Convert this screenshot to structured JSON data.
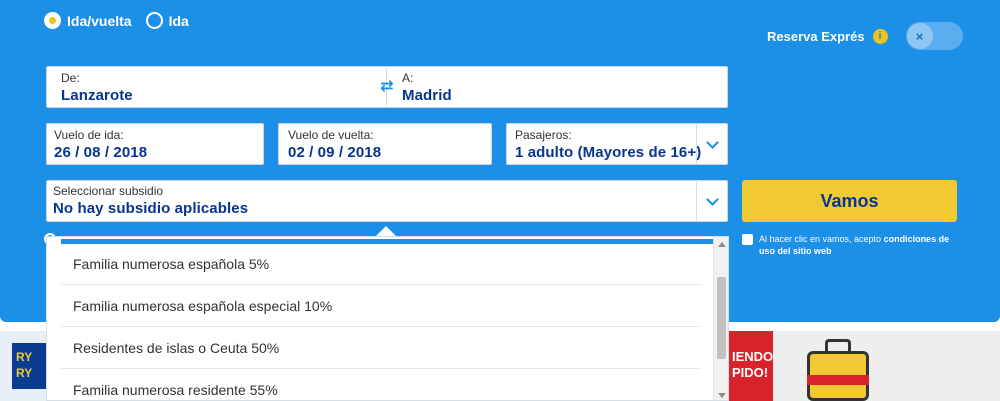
{
  "trip_type": {
    "options": [
      {
        "label": "Ida/vuelta",
        "selected": true
      },
      {
        "label": "Ida",
        "selected": false
      }
    ]
  },
  "express": {
    "label": "Reserva Exprés",
    "info_icon": "i",
    "toggle_icon": "×",
    "enabled": false
  },
  "route": {
    "from_label": "De:",
    "from_value": "Lanzarote",
    "to_label": "A:",
    "to_value": "Madrid",
    "swap_icon": "⇄"
  },
  "dates": {
    "outbound_label": "Vuelo de ida:",
    "outbound_value": "26 / 08 / 2018",
    "return_label": "Vuelo de vuelta:",
    "return_value": "02 / 09 / 2018"
  },
  "passengers": {
    "label": "Pasajeros:",
    "value": "1 adulto (Mayores de 16+)"
  },
  "subsidy": {
    "label": "Seleccionar subsidio",
    "value": "No hay subsidio aplicables",
    "options": [
      "Familia numerosa española 5%",
      "Familia numerosa española especial 10%",
      "Residentes de islas o Ceuta 50%",
      "Familia numerosa residente 55%"
    ]
  },
  "submit": {
    "label": "Vamos"
  },
  "terms": {
    "text": "Al hacer clic en vamos, acepto ",
    "link": "condiciones de uso del sitio web"
  },
  "banners": {
    "left_text": "RY RY",
    "right_text": "IENDO PIDO!"
  },
  "colors": {
    "panel": "#1c8fe6",
    "accent": "#f1c933",
    "value_text": "#073590"
  }
}
